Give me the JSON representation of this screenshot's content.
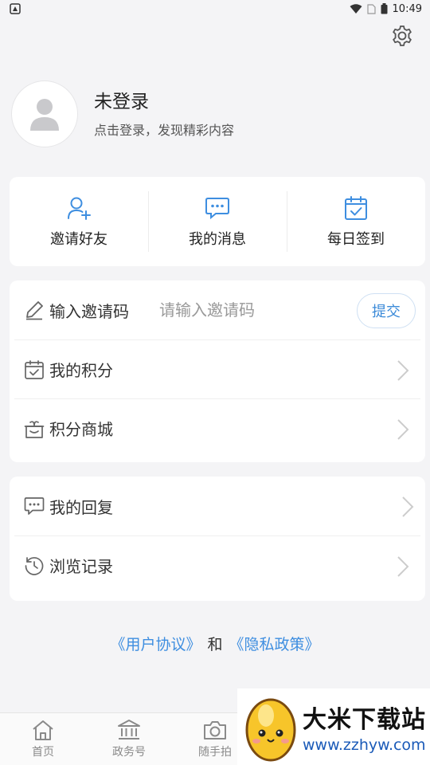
{
  "status_bar": {
    "time": "10:49"
  },
  "profile": {
    "name": "未登录",
    "subtitle": "点击登录，发现精彩内容"
  },
  "quick_actions": [
    {
      "label": "邀请好友",
      "icon": "add-user-icon"
    },
    {
      "label": "我的消息",
      "icon": "message-icon"
    },
    {
      "label": "每日签到",
      "icon": "calendar-check-icon"
    }
  ],
  "invite": {
    "label": "输入邀请码",
    "placeholder": "请输入邀请码",
    "submit_label": "提交"
  },
  "menu1": [
    {
      "label": "我的积分",
      "icon": "points-calendar-icon"
    },
    {
      "label": "积分商城",
      "icon": "gift-box-icon"
    }
  ],
  "menu2": [
    {
      "label": "我的回复",
      "icon": "reply-chat-icon"
    },
    {
      "label": "浏览记录",
      "icon": "history-clock-icon"
    }
  ],
  "agreement": {
    "user_agreement": "《用户协议》",
    "and": "和",
    "privacy_policy": "《隐私政策》"
  },
  "tabbar": [
    {
      "label": "首页",
      "icon": "home-icon"
    },
    {
      "label": "政务号",
      "icon": "government-building-icon"
    },
    {
      "label": "随手拍",
      "icon": "camera-icon"
    }
  ],
  "watermark": {
    "title": "大米下载站",
    "url": "www.zzhyw.com"
  },
  "colors": {
    "accent": "#3e8ee0",
    "background": "#f4f4f6",
    "card": "#ffffff"
  }
}
